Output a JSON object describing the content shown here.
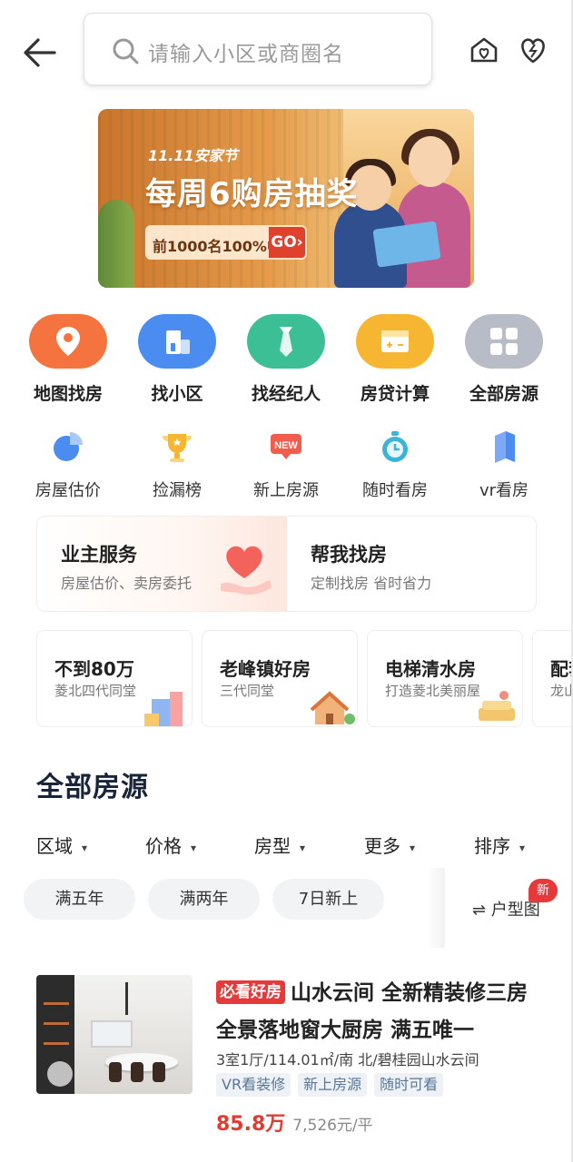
{
  "search": {
    "placeholder": "请输入小区或商圈名"
  },
  "banner": {
    "tag": "11.11安家节",
    "title": "每周6购房抽奖",
    "promo": "前1000名100%中奖",
    "cta": "GO›"
  },
  "main_nav": [
    {
      "label": "地图找房",
      "icon": "map-pin-icon",
      "color": "#f4733f"
    },
    {
      "label": "找小区",
      "icon": "building-icon",
      "color": "#4a8cf0"
    },
    {
      "label": "找经纪人",
      "icon": "agent-tie-icon",
      "color": "#3cbf95"
    },
    {
      "label": "房贷计算",
      "icon": "calculator-icon",
      "color": "#f7b631"
    },
    {
      "label": "全部房源",
      "icon": "grid-icon",
      "color": "#b8bcc6"
    }
  ],
  "sub_nav": [
    {
      "label": "房屋估价",
      "icon": "pie-chart-icon"
    },
    {
      "label": "捡漏榜",
      "icon": "trophy-icon"
    },
    {
      "label": "新上房源",
      "icon": "new-badge-icon"
    },
    {
      "label": "随时看房",
      "icon": "stopwatch-icon"
    },
    {
      "label": "vr看房",
      "icon": "vr-cube-icon"
    }
  ],
  "services": {
    "owner": {
      "title": "业主服务",
      "subtitle": "房屋估价、卖房委托"
    },
    "help": {
      "title": "帮我找房",
      "subtitle": "定制找房 省时省力"
    }
  },
  "themes": [
    {
      "title": "不到80万",
      "subtitle": "菱北四代同堂"
    },
    {
      "title": "老峰镇好房",
      "subtitle": "三代同堂"
    },
    {
      "title": "电梯清水房",
      "subtitle": "打造菱北美丽屋"
    },
    {
      "title": "配套",
      "subtitle": "龙山"
    }
  ],
  "section": {
    "title": "全部房源"
  },
  "filters": [
    "区域",
    "价格",
    "房型",
    "更多",
    "排序"
  ],
  "chips": [
    "满五年",
    "满两年",
    "7日新上"
  ],
  "layout_button": {
    "label": "⇌ 户型图",
    "badge": "新"
  },
  "listing": {
    "badge": "必看好房",
    "title": "山水云间 全新精装修三房 全景落地窗大厨房 满五唯一",
    "info": "3室1厅/114.01㎡/南 北/碧桂园山水云间",
    "tags": [
      "VR看装修",
      "新上房源",
      "随时可看"
    ],
    "price": "85.8万",
    "unit_price": "7,526元/平"
  }
}
